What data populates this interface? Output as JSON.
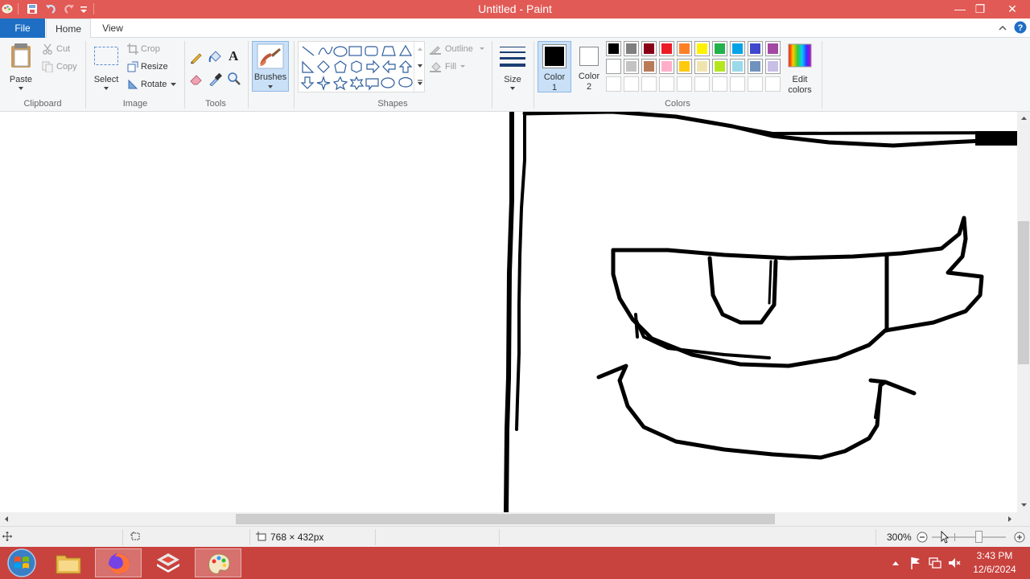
{
  "window": {
    "title": "Untitled - Paint",
    "controls": {
      "minimize": "—",
      "maximize": "❐",
      "close": "✕"
    }
  },
  "tabs": [
    {
      "label": "File"
    },
    {
      "label": "Home"
    },
    {
      "label": "View"
    }
  ],
  "ribbon": {
    "clipboard": {
      "paste": "Paste",
      "cut": "Cut",
      "copy": "Copy",
      "group": "Clipboard"
    },
    "image": {
      "select": "Select",
      "crop": "Crop",
      "resize": "Resize",
      "rotate": "Rotate",
      "group": "Image"
    },
    "tools": {
      "group": "Tools"
    },
    "brushes": {
      "label": "Brushes"
    },
    "shapes": {
      "outline": "Outline",
      "fill": "Fill",
      "group": "Shapes"
    },
    "size": {
      "label": "Size"
    },
    "colors": {
      "color1_line1": "Color",
      "color1_line2": "1",
      "color2_line1": "Color",
      "color2_line2": "2",
      "edit_line1": "Edit",
      "edit_line2": "colors",
      "group": "Colors",
      "color1_value": "#000000",
      "color2_value": "#ffffff",
      "palette_row1": [
        "#000000",
        "#7f7f7f",
        "#880015",
        "#ed1c24",
        "#ff7f27",
        "#fff200",
        "#22b14c",
        "#00a2e8",
        "#3f48cc",
        "#a349a4"
      ],
      "palette_row2": [
        "#ffffff",
        "#c3c3c3",
        "#b97a57",
        "#ffaec9",
        "#ffc90e",
        "#efe4b0",
        "#b5e61d",
        "#99d9ea",
        "#7092be",
        "#c8bfe7"
      ]
    }
  },
  "status": {
    "canvas_size": "768 × 432px",
    "zoom": "300%"
  },
  "taskbar": {
    "time": "3:43 PM",
    "date": "12/6/2024"
  },
  "theme": {
    "titlebar": "#e25a55",
    "taskbar": "#c8423e",
    "file_tab": "#1e6fc4"
  }
}
